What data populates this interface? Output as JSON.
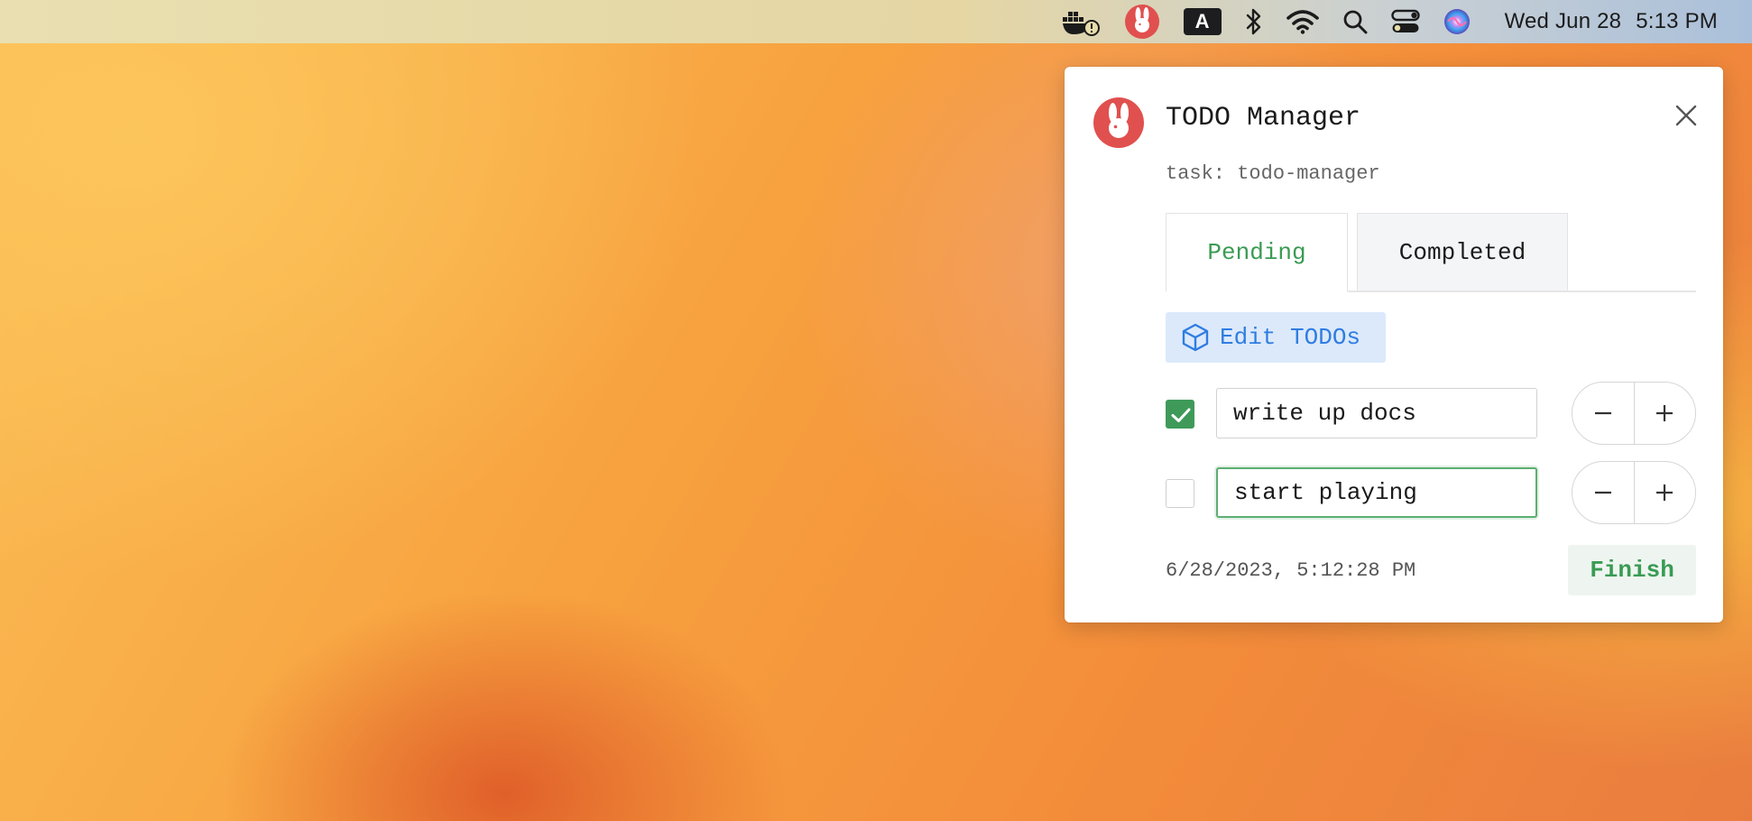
{
  "menubar": {
    "icons": [
      "docker-alert-icon",
      "rabbit-app-icon",
      "input-source-icon",
      "bluetooth-icon",
      "wifi-icon",
      "spotlight-search-icon",
      "control-center-icon",
      "siri-icon"
    ],
    "input_source_letter": "A",
    "clock_date": "Wed Jun 28",
    "clock_time": "5:13 PM"
  },
  "popover": {
    "title": "TODO Manager",
    "subtitle": "task: todo-manager",
    "tabs": [
      {
        "label": "Pending",
        "active": true
      },
      {
        "label": "Completed",
        "active": false
      }
    ],
    "edit_button_label": "Edit TODOs",
    "todos": [
      {
        "text": "write up docs",
        "checked": true,
        "focused": false
      },
      {
        "text": "start playing",
        "checked": false,
        "focused": true
      }
    ],
    "timestamp": "6/28/2023, 5:12:28 PM",
    "finish_label": "Finish"
  },
  "colors": {
    "accent_green": "#3a9b54",
    "accent_blue": "#2f7de1",
    "brand_red": "#e0504e"
  }
}
